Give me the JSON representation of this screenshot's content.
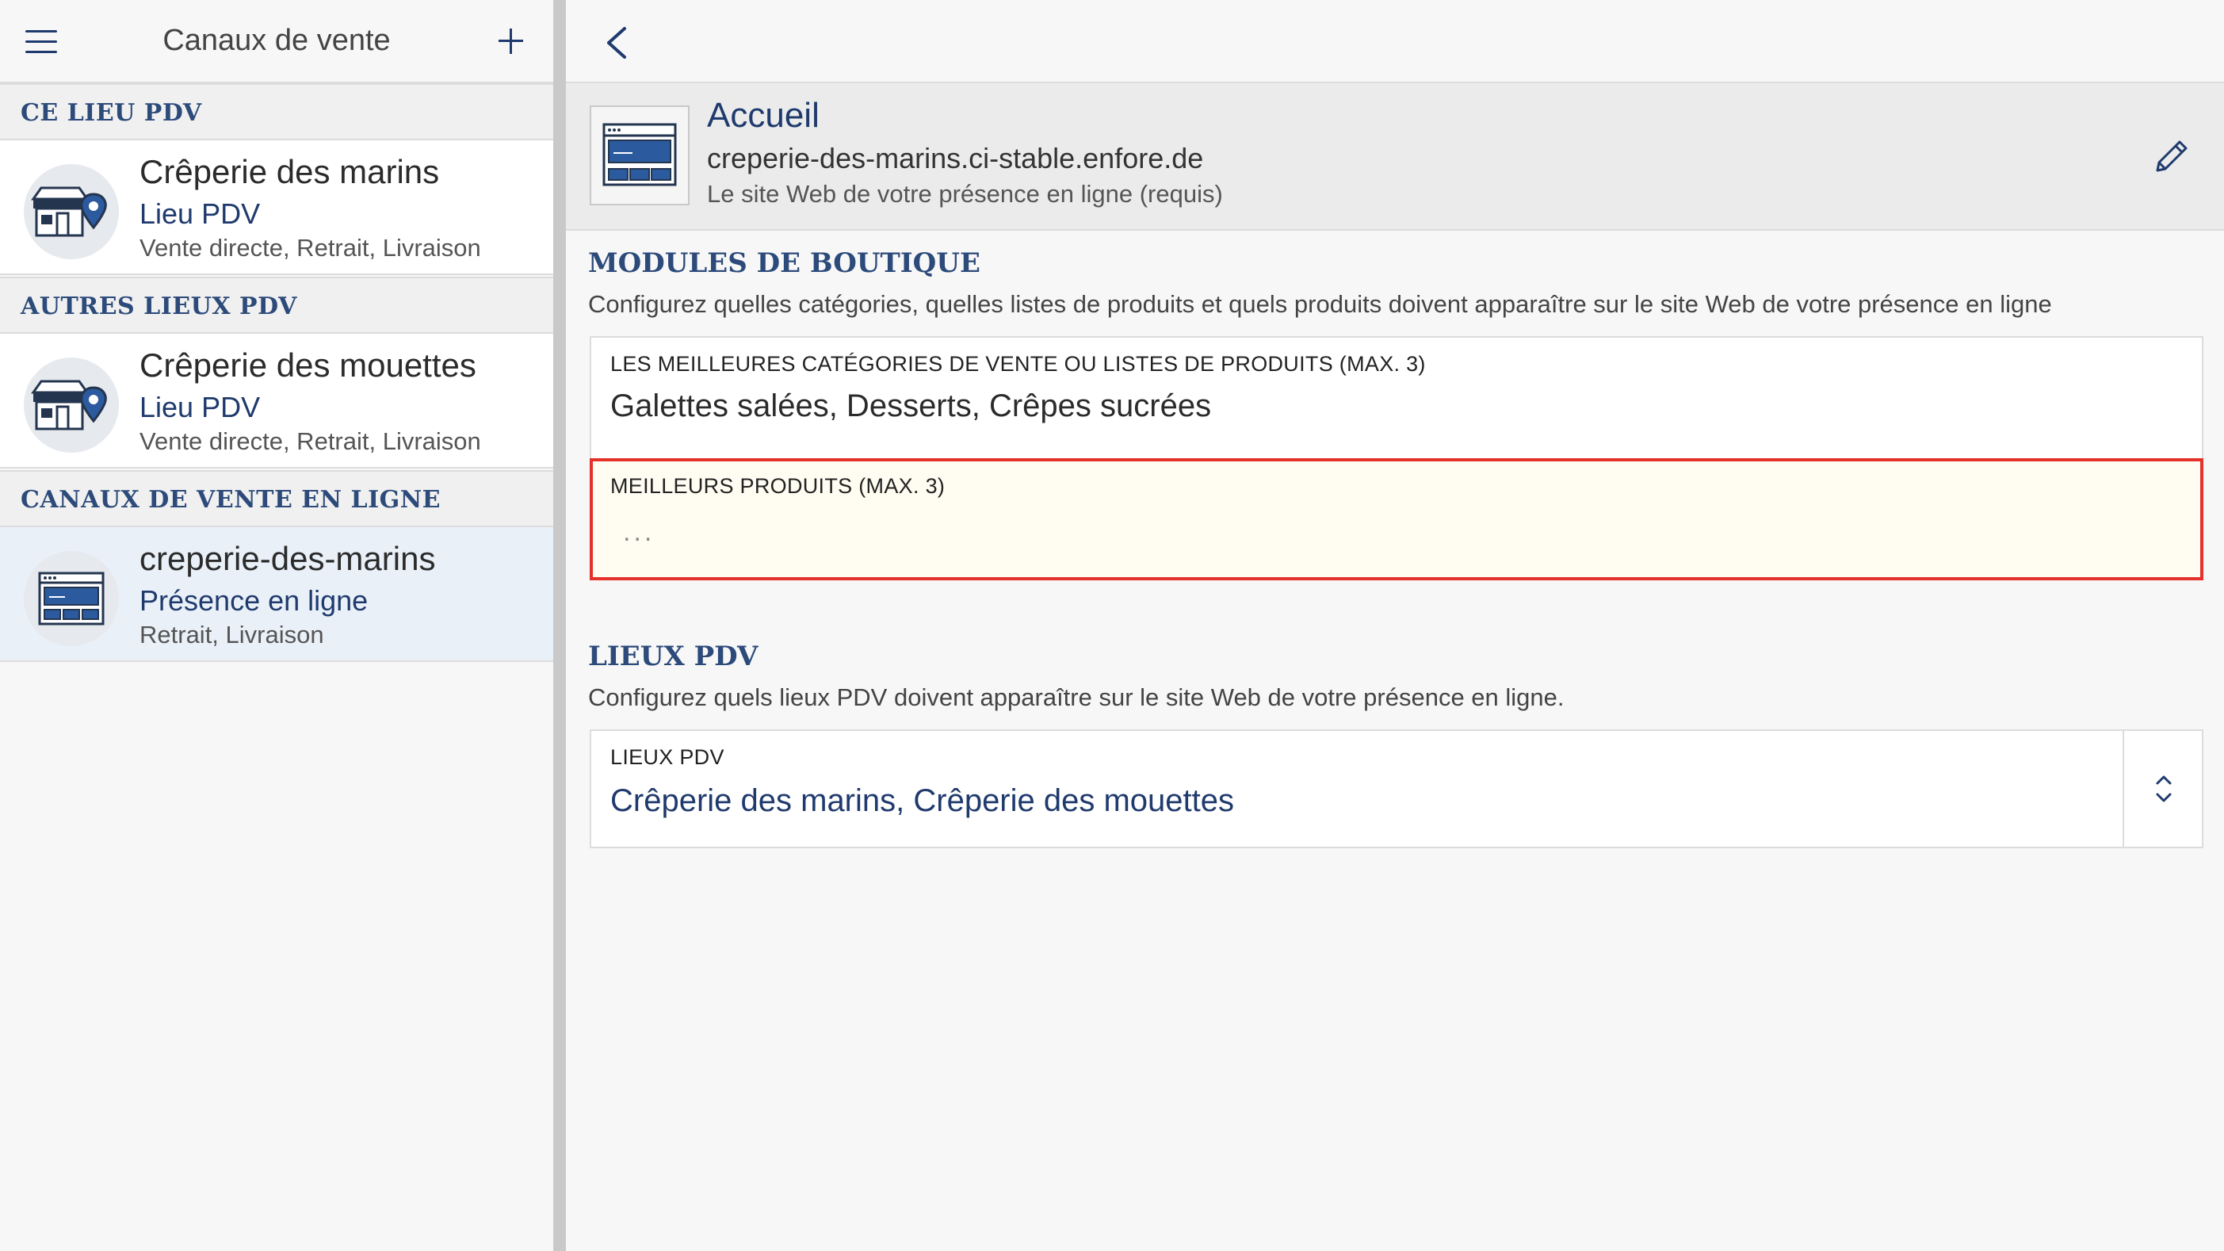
{
  "left_panel": {
    "title": "Canaux de vente",
    "sections": [
      {
        "heading": "CE LIEU PDV",
        "items": [
          {
            "title": "Crêperie des marins",
            "subtitle": "Lieu PDV",
            "description": "Vente directe, Retrait, Livraison",
            "icon": "store-location-icon"
          }
        ]
      },
      {
        "heading": "AUTRES LIEUX PDV",
        "items": [
          {
            "title": "Crêperie des mouettes",
            "subtitle": "Lieu PDV",
            "description": "Vente directe, Retrait, Livraison",
            "icon": "store-location-icon"
          }
        ]
      },
      {
        "heading": "CANAUX DE VENTE EN LIGNE",
        "items": [
          {
            "title": "creperie-des-marins",
            "subtitle": "Présence en ligne",
            "description": "Retrait, Livraison",
            "icon": "website-icon",
            "selected": true
          }
        ]
      }
    ]
  },
  "detail": {
    "summary": {
      "title": "Accueil",
      "url": "creperie-des-marins.ci-stable.enfore.de",
      "description": "Le site Web de votre présence en ligne (requis)"
    },
    "shop_modules": {
      "heading": "MODULES DE BOUTIQUE",
      "description": "Configurez quelles catégories, quelles listes de produits et quels produits doivent apparaître sur le site Web de votre présence en ligne",
      "top_categories": {
        "label": "LES MEILLEURES CATÉGORIES DE VENTE OU LISTES DE PRODUITS (MAX. 3)",
        "value": "Galettes salées, Desserts, Crêpes sucrées"
      },
      "top_products": {
        "label": "MEILLEURS PRODUITS (MAX. 3)",
        "placeholder": "..."
      }
    },
    "locations": {
      "heading": "LIEUX PDV",
      "description": "Configurez quels lieux PDV doivent apparaître sur le site Web de votre présence en ligne.",
      "field": {
        "label": "LIEUX PDV",
        "value": "Crêperie des marins, Crêperie des mouettes"
      }
    }
  },
  "colors": {
    "accent": "#1f3a6d",
    "heading": "#2c4a7a",
    "highlight_border": "#e4322b",
    "highlight_bg": "#fffdf1"
  }
}
